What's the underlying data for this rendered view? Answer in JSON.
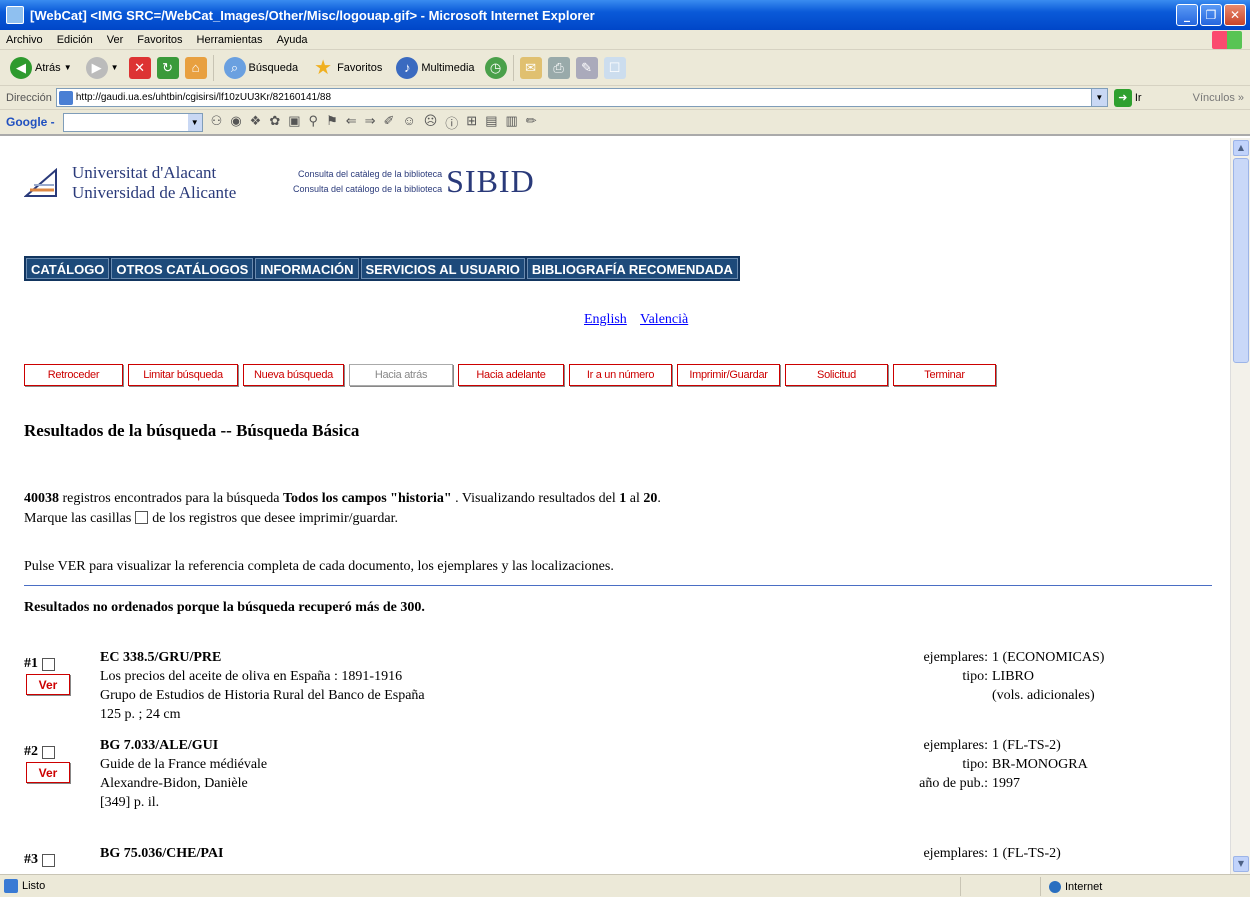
{
  "window": {
    "title": "[WebCat] <IMG SRC=/WebCat_Images/Other/Misc/logouap.gif> - Microsoft Internet Explorer",
    "minimize": "_",
    "maximize": "❐",
    "close": "✕"
  },
  "menu": [
    "Archivo",
    "Edición",
    "Ver",
    "Favoritos",
    "Herramientas",
    "Ayuda"
  ],
  "toolbar": {
    "back": "Atrás",
    "search": "Búsqueda",
    "favorites": "Favoritos",
    "media": "Multimedia"
  },
  "address": {
    "label": "Dirección",
    "url": "http://gaudi.ua.es/uhtbin/cgisirsi/lf10zUU3Kr/82160141/88",
    "go": "Ir",
    "links": "Vínculos »"
  },
  "google": {
    "logo": "Google -"
  },
  "page": {
    "uni_line1": "Universitat d'Alacant",
    "uni_line2": "Universidad de Alicante",
    "sibid_small1": "Consulta del catàleg de la biblioteca",
    "sibid_small2": "Consulta del catálogo de la biblioteca",
    "sibid": "SIBID",
    "nav": [
      "CATÁLOGO",
      "OTROS CATÁLOGOS",
      "INFORMACIÓN",
      "SERVICIOS AL USUARIO",
      "BIBLIOGRAFÍA RECOMENDADA"
    ],
    "lang_english": "English",
    "lang_valencia": "Valencià",
    "actions": [
      {
        "label": "Retroceder",
        "enabled": true
      },
      {
        "label": "Limitar búsqueda",
        "enabled": true
      },
      {
        "label": "Nueva búsqueda",
        "enabled": true
      },
      {
        "label": "Hacia atrás",
        "enabled": false
      },
      {
        "label": "Hacia adelante",
        "enabled": true
      },
      {
        "label": "Ir a un número",
        "enabled": true
      },
      {
        "label": "Imprimir/Guardar",
        "enabled": true
      },
      {
        "label": "Solicitud",
        "enabled": true
      },
      {
        "label": "Terminar",
        "enabled": true
      }
    ],
    "heading": "Resultados de la búsqueda -- Búsqueda Básica",
    "summary": {
      "count": "40038",
      "text1": " registros encontrados para la búsqueda ",
      "query": "Todos los campos \"historia\"",
      "text2": " . Visualizando resultados del ",
      "from": "1",
      "text3": " al ",
      "to": "20",
      "text4": "."
    },
    "mark_text1": "Marque las casillas",
    "mark_text2": "de los registros que desee imprimir/guardar.",
    "pulse_text": "Pulse VER para visualizar la referencia completa de cada documento, los ejemplares y las localizaciones.",
    "not_sorted": "Resultados no ordenados porque la búsqueda recuperó más de 300.",
    "ver_label": "Ver",
    "records": [
      {
        "num": "#1",
        "call": "EC 338.5/GRU/PRE",
        "title": "Los precios del aceite de oliva en España : 1891-1916",
        "author": "Grupo de Estudios de Historia Rural del Banco de España",
        "desc": "125 p. ; 24 cm",
        "meta": [
          {
            "k": "ejemplares:",
            "v": "1 (ECONOMICAS)"
          },
          {
            "k": "tipo:",
            "v": "LIBRO"
          },
          {
            "k": "",
            "v": "(vols. adicionales)"
          }
        ]
      },
      {
        "num": "#2",
        "call": "BG 7.033/ALE/GUI",
        "title": "Guide de la France médiévale",
        "author": "Alexandre-Bidon, Danièle",
        "desc": "[349] p. il.",
        "meta": [
          {
            "k": "ejemplares:",
            "v": "1 (FL-TS-2)"
          },
          {
            "k": "tipo:",
            "v": "BR-MONOGRA"
          },
          {
            "k": "año de pub.:",
            "v": "1997"
          }
        ]
      },
      {
        "num": "#3",
        "call": "BG 75.036/CHE/PAI",
        "title": "",
        "author": "",
        "desc": "",
        "meta": [
          {
            "k": "ejemplares:",
            "v": "1 (FL-TS-2)"
          }
        ]
      }
    ]
  },
  "status": {
    "left": "Listo",
    "zone": "Internet"
  }
}
